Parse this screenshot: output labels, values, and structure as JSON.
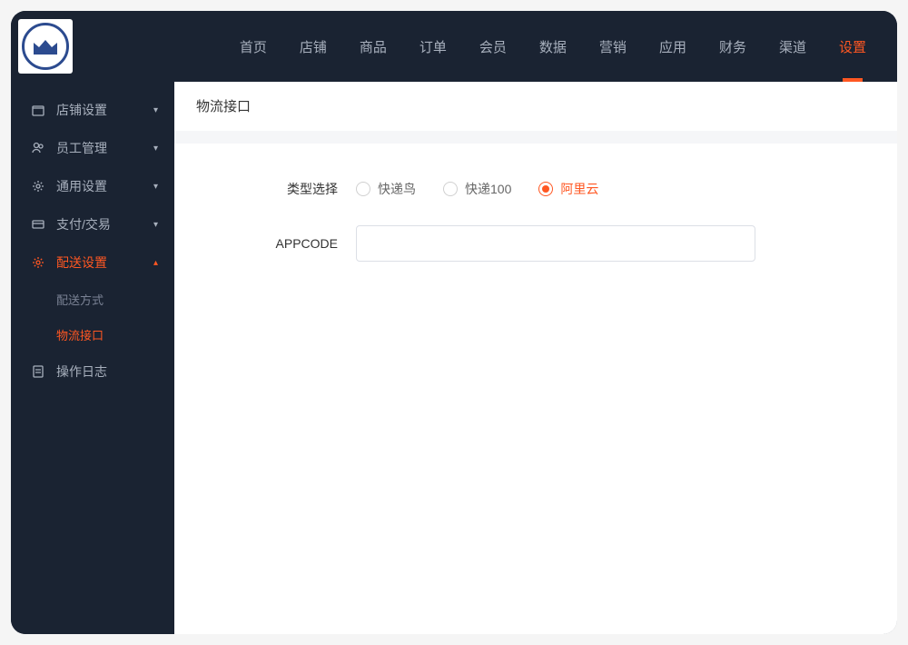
{
  "topNav": {
    "items": [
      {
        "label": "首页"
      },
      {
        "label": "店铺"
      },
      {
        "label": "商品"
      },
      {
        "label": "订单"
      },
      {
        "label": "会员"
      },
      {
        "label": "数据"
      },
      {
        "label": "营销"
      },
      {
        "label": "应用"
      },
      {
        "label": "财务"
      },
      {
        "label": "渠道"
      },
      {
        "label": "设置"
      }
    ]
  },
  "sidebar": {
    "items": [
      {
        "label": "店铺设置"
      },
      {
        "label": "员工管理"
      },
      {
        "label": "通用设置"
      },
      {
        "label": "支付/交易"
      },
      {
        "label": "配送设置"
      },
      {
        "label": "操作日志"
      }
    ],
    "subitems": [
      {
        "label": "配送方式"
      },
      {
        "label": "物流接口"
      }
    ]
  },
  "page": {
    "title": "物流接口"
  },
  "form": {
    "typeLabel": "类型选择",
    "appcodeLabel": "APPCODE",
    "appcodeValue": "",
    "radios": [
      {
        "label": "快递鸟"
      },
      {
        "label": "快递100"
      },
      {
        "label": "阿里云"
      }
    ]
  }
}
